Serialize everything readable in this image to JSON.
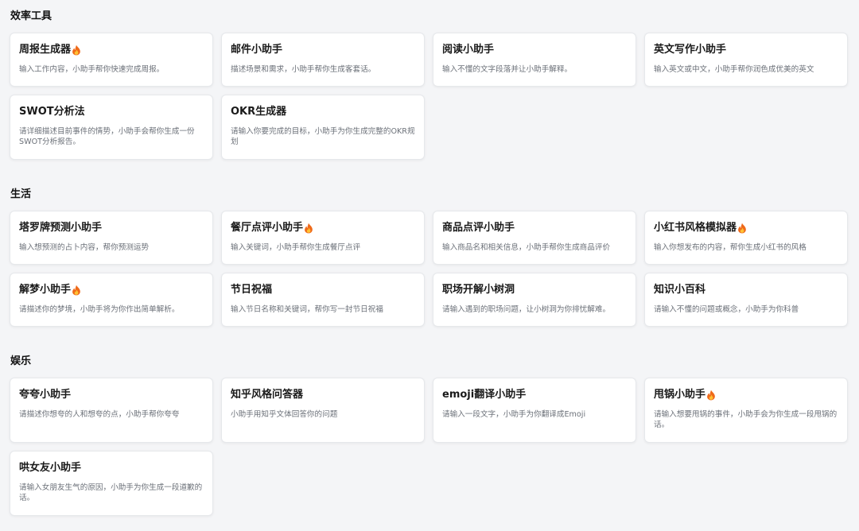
{
  "sections": [
    {
      "title": "效率工具",
      "cards": [
        {
          "title": "周报生成器",
          "hot": true,
          "desc": "输入工作内容，小助手帮你快速完成周报。"
        },
        {
          "title": "邮件小助手",
          "hot": false,
          "desc": "描述场景和需求，小助手帮你生成客套话。"
        },
        {
          "title": "阅读小助手",
          "hot": false,
          "desc": "输入不懂的文字段落并让小助手解释。"
        },
        {
          "title": "英文写作小助手",
          "hot": false,
          "desc": "输入英文或中文，小助手帮你润色成优美的英文"
        },
        {
          "title": "SWOT分析法",
          "hot": false,
          "desc": "请详细描述目前事件的情势，小助手会帮你生成一份SWOT分析报告。"
        },
        {
          "title": "OKR生成器",
          "hot": false,
          "desc": "请输入你要完成的目标，小助手为你生成完整的OKR规划"
        }
      ]
    },
    {
      "title": "生活",
      "cards": [
        {
          "title": "塔罗牌预测小助手",
          "hot": false,
          "desc": "输入想预测的占卜内容，帮你预测运势"
        },
        {
          "title": "餐厅点评小助手",
          "hot": true,
          "desc": "输入关键词，小助手帮你生成餐厅点评"
        },
        {
          "title": "商品点评小助手",
          "hot": false,
          "desc": "输入商品名和相关信息，小助手帮你生成商品评价"
        },
        {
          "title": "小红书风格模拟器",
          "hot": true,
          "desc": "输入你想发布的内容，帮你生成小红书的风格"
        },
        {
          "title": "解梦小助手",
          "hot": true,
          "desc": "请描述你的梦境，小助手将为你作出简单解析。"
        },
        {
          "title": "节日祝福",
          "hot": false,
          "desc": "输入节日名称和关键词，帮你写一封节日祝福"
        },
        {
          "title": "职场开解小树洞",
          "hot": false,
          "desc": "请输入遇到的职场问题，让小树洞为你排忧解难。"
        },
        {
          "title": "知识小百科",
          "hot": false,
          "desc": "请输入不懂的问题或概念，小助手为你科普"
        }
      ]
    },
    {
      "title": "娱乐",
      "cards": [
        {
          "title": "夸夸小助手",
          "hot": false,
          "desc": "请描述你想夸的人和想夸的点，小助手帮你夸夸"
        },
        {
          "title": "知乎风格问答器",
          "hot": false,
          "desc": "小助手用知乎文体回答你的问题"
        },
        {
          "title": "emoji翻译小助手",
          "hot": false,
          "desc": "请输入一段文字，小助手为你翻译成Emoji"
        },
        {
          "title": "甩锅小助手",
          "hot": true,
          "desc": "请输入想要甩锅的事件，小助手会为你生成一段甩锅的话。"
        },
        {
          "title": "哄女友小助手",
          "hot": false,
          "desc": "请输入女朋友生气的原因，小助手为你生成一段道歉的话。"
        }
      ]
    }
  ],
  "icons": {
    "hot": "fire-icon"
  },
  "colors": {
    "background": "#f4f5f7",
    "card": "#ffffff",
    "fire_outer": "#ef6a1a",
    "fire_inner": "#ffc233"
  }
}
